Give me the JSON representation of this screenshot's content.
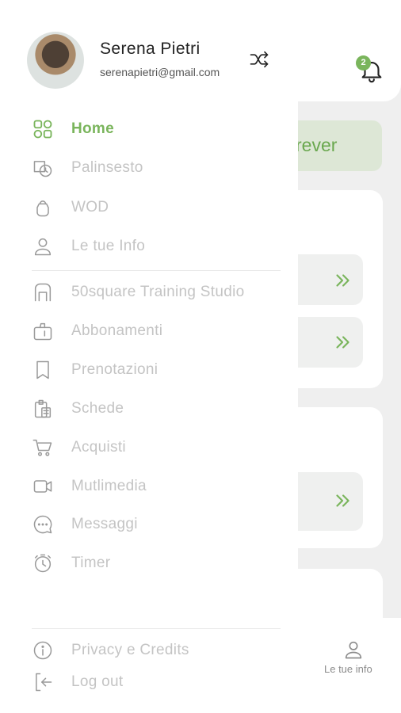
{
  "background": {
    "notification_count": "2",
    "banner_text": "rever",
    "tabbar": {
      "tab_label": "Le tue info"
    }
  },
  "user": {
    "name": "Serena Pietri",
    "email": "serenapietri@gmail.com"
  },
  "menu": {
    "main": [
      {
        "label": "Home",
        "icon": "grid-icon",
        "active": true
      },
      {
        "label": "Palinsesto",
        "icon": "schedule-icon"
      },
      {
        "label": "WOD",
        "icon": "kettlebell-icon"
      },
      {
        "label": "Le tue Info",
        "icon": "user-icon"
      }
    ],
    "studio": [
      {
        "label": "50square Training Studio",
        "icon": "gym-icon"
      },
      {
        "label": "Abbonamenti",
        "icon": "membership-icon"
      },
      {
        "label": "Prenotazioni",
        "icon": "bookmark-icon"
      },
      {
        "label": "Schede",
        "icon": "clipboard-icon"
      },
      {
        "label": "Acquisti",
        "icon": "cart-icon"
      },
      {
        "label": "Mutlimedia",
        "icon": "video-icon"
      },
      {
        "label": "Messaggi",
        "icon": "chat-icon"
      },
      {
        "label": "Timer",
        "icon": "stopwatch-icon"
      }
    ],
    "footer": [
      {
        "label": "Privacy e Credits",
        "icon": "info-icon"
      },
      {
        "label": "Log out",
        "icon": "logout-icon"
      }
    ]
  },
  "colors": {
    "accent": "#7ab55c",
    "inactive": "#c4c4c4"
  }
}
